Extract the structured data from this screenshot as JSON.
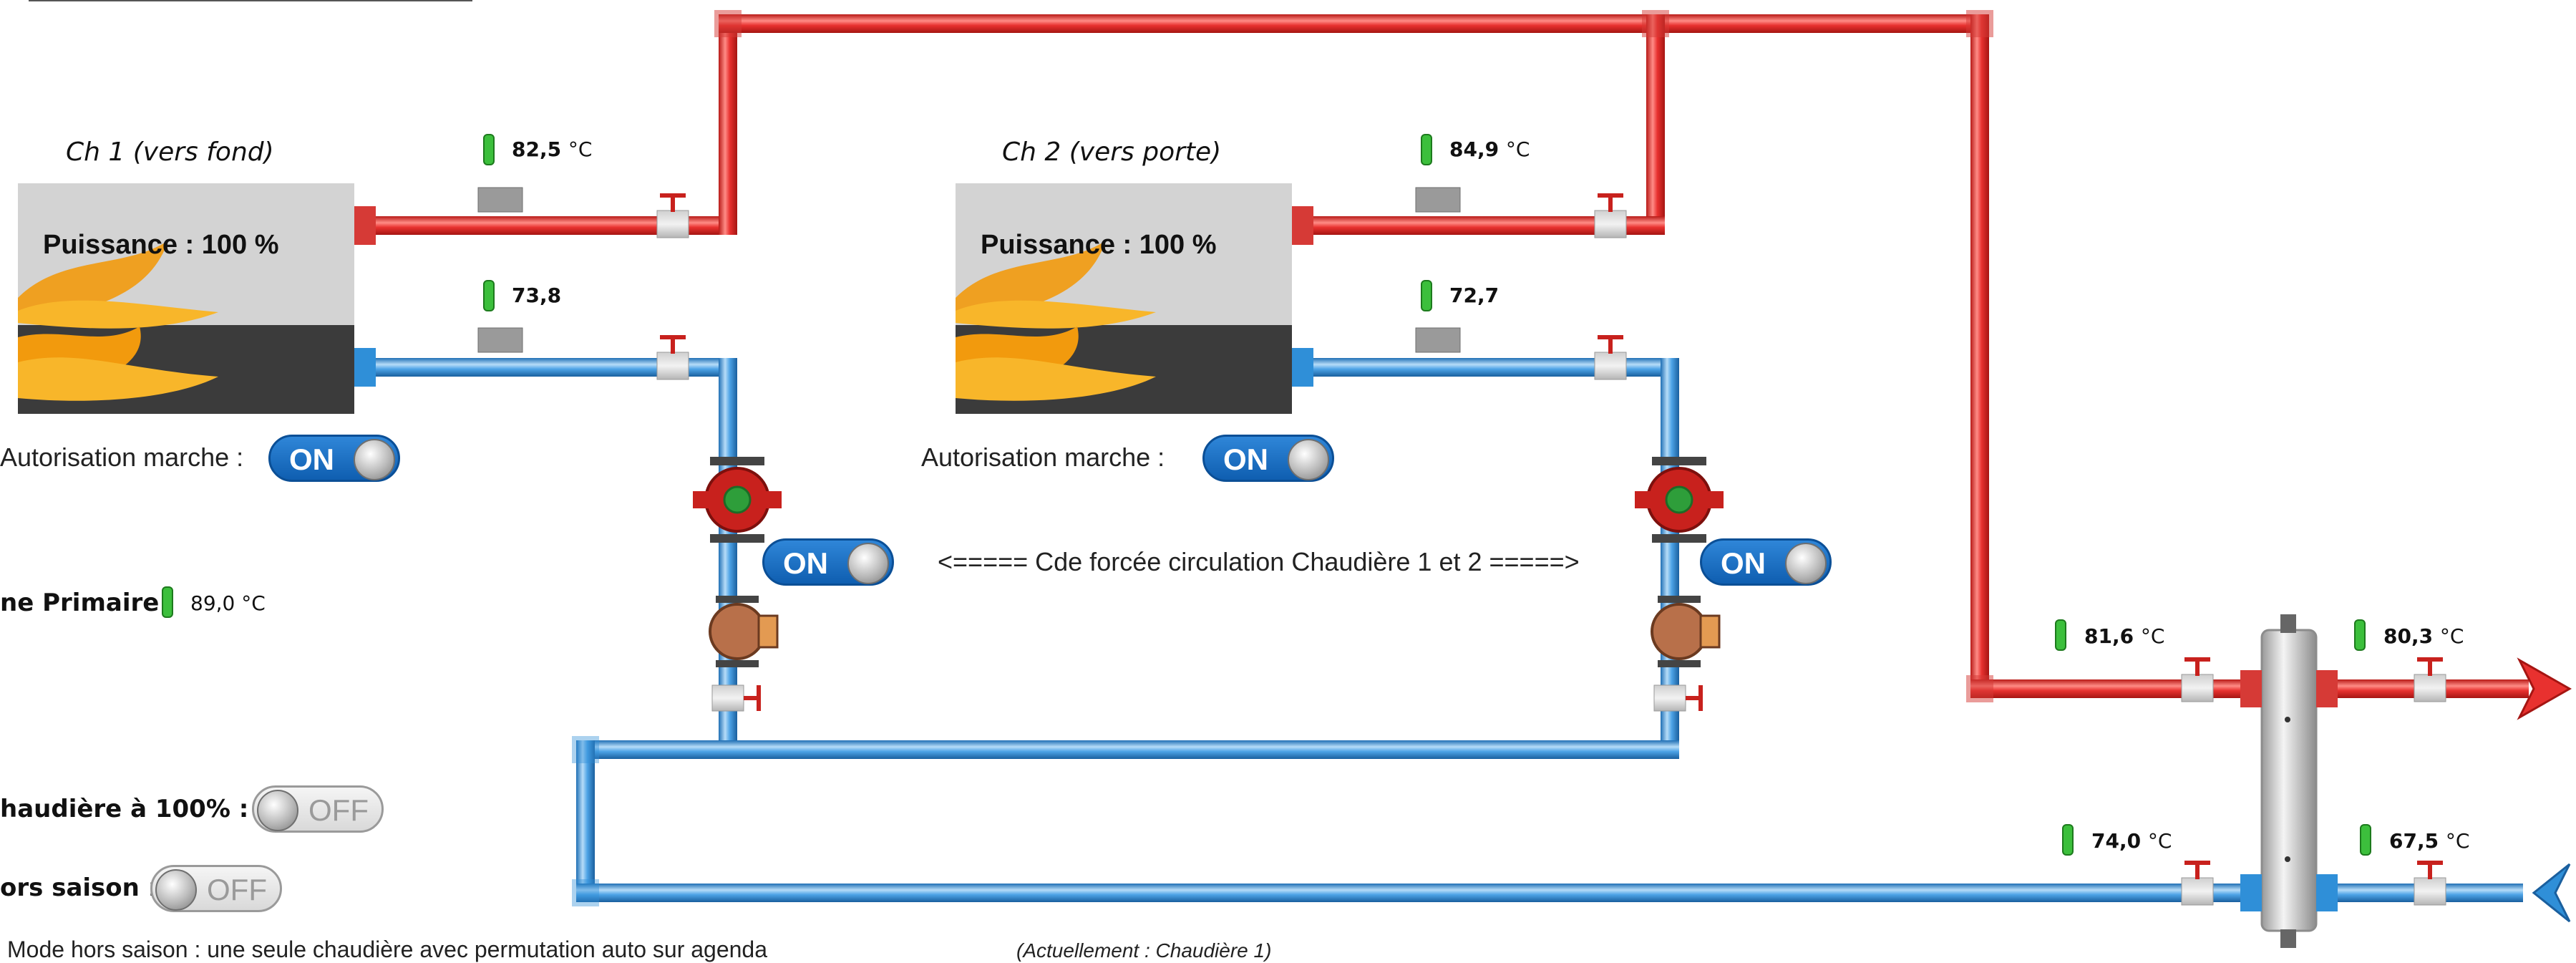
{
  "boilers": [
    {
      "name": "Ch 1 (vers fond)",
      "power": "Puissance : 100 %",
      "supply_temp": "82,5",
      "return_temp": "73,8",
      "autorisation_label": "Autorisation marche :",
      "autorisation_state": "ON"
    },
    {
      "name": "Ch 2 (vers porte)",
      "power": "Puissance : 100 %",
      "supply_temp": "84,9",
      "return_temp": "72,7",
      "autorisation_label": "Autorisation marche :",
      "autorisation_state": "ON"
    }
  ],
  "temp_unit": "°C",
  "pump_toggles": [
    "ON",
    "ON"
  ],
  "forced_circulation_label": "<===== Cde forcée circulation Chaudière 1 et 2 =====>",
  "primary": {
    "label": "ne Primaire",
    "temp": "89,0",
    "unit": "°C"
  },
  "chaudiere_100": {
    "label": "haudière à 100% :",
    "state": "OFF"
  },
  "hors_saison": {
    "label": "ors saison :",
    "state": "OFF"
  },
  "bottom_note": "Mode hors saison : une seule chaudière avec permutation auto sur agenda",
  "current_note": "(Actuellement : Chaudière 1)",
  "separator_temps": {
    "hot_in": "81,6",
    "hot_out": "80,3",
    "cold_in": "74,0",
    "cold_out": "67,5"
  },
  "colors": {
    "hot_pipe": "#e8312f",
    "cold_pipe": "#2f8fd8",
    "toggle_on": "#1a6fc4"
  }
}
